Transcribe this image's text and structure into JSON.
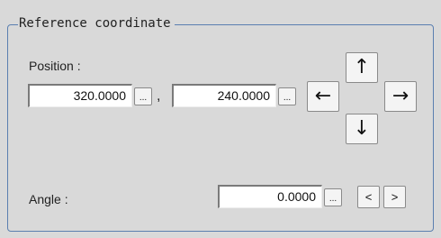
{
  "group": {
    "title": "Reference coordinate"
  },
  "position": {
    "label": "Position :",
    "x_value": "320.0000",
    "y_value": "240.0000",
    "separator": ",",
    "ellipsis": "..."
  },
  "arrows": {
    "up": "↑",
    "down": "↓",
    "left": "←",
    "right": "→"
  },
  "angle": {
    "label": "Angle :",
    "value": "0.0000",
    "ellipsis": "...",
    "decrease": "<",
    "increase": ">"
  }
}
